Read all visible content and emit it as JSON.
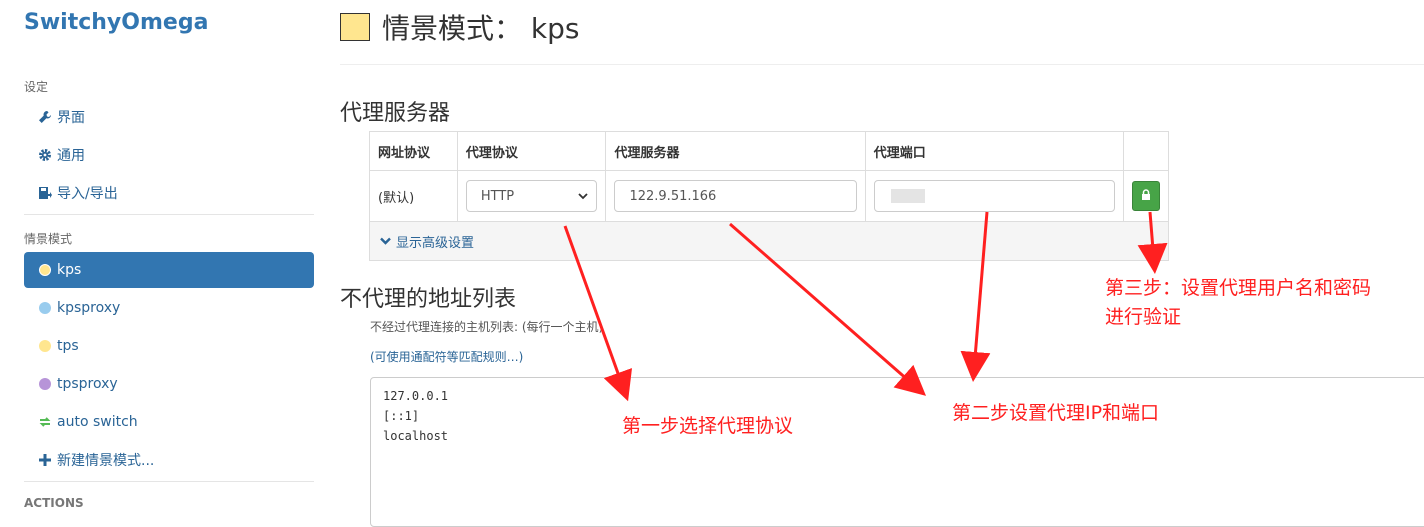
{
  "app": {
    "brand": "SwitchyOmega"
  },
  "sidebar": {
    "settings_title": "设定",
    "settings_items": [
      {
        "label": "界面",
        "icon": "wrench-icon"
      },
      {
        "label": "通用",
        "icon": "gear-icon"
      },
      {
        "label": "导入/导出",
        "icon": "import-export-icon"
      }
    ],
    "profiles_title": "情景模式",
    "profiles": [
      {
        "label": "kps",
        "icon": "globe-icon",
        "color": "#ffe68f",
        "active": true
      },
      {
        "label": "kpsproxy",
        "icon": "globe-icon",
        "color": "#99ccee"
      },
      {
        "label": "tps",
        "icon": "globe-icon",
        "color": "#ffe68f"
      },
      {
        "label": "tpsproxy",
        "icon": "globe-icon",
        "color": "#b794d8"
      },
      {
        "label": "auto switch",
        "icon": "switch-icon",
        "color": "#55bb55"
      },
      {
        "label": "新建情景模式...",
        "icon": "plus-icon"
      }
    ],
    "actions_title": "ACTIONS"
  },
  "main": {
    "profile_title": "情景模式：  kps",
    "profile_color": "#ffe68f",
    "proxy_section_title": "代理服务器",
    "table": {
      "headers": [
        "网址协议",
        "代理协议",
        "代理服务器",
        "代理端口"
      ],
      "row": {
        "scheme": "(默认)",
        "protocol": "HTTP",
        "server": "122.9.51.166",
        "port": ""
      },
      "advanced_link": "显示高级设置"
    },
    "bypass_section_title": "不代理的地址列表",
    "bypass_help": "不经过代理连接的主机列表: (每行一个主机)",
    "bypass_link": "(可使用通配符等匹配规则…)",
    "bypass_list": [
      "127.0.0.1",
      "[::1]",
      "localhost"
    ]
  },
  "annotations": {
    "step1": "第一步选择代理协议",
    "step2": "第二步设置代理IP和端口",
    "step3_line1": "第三步：设置代理用户名和密码",
    "step3_line2": "进行验证"
  },
  "colors": {
    "accent": "#3276b1",
    "annotation": "#ff2020",
    "lock_button": "#47a447"
  }
}
